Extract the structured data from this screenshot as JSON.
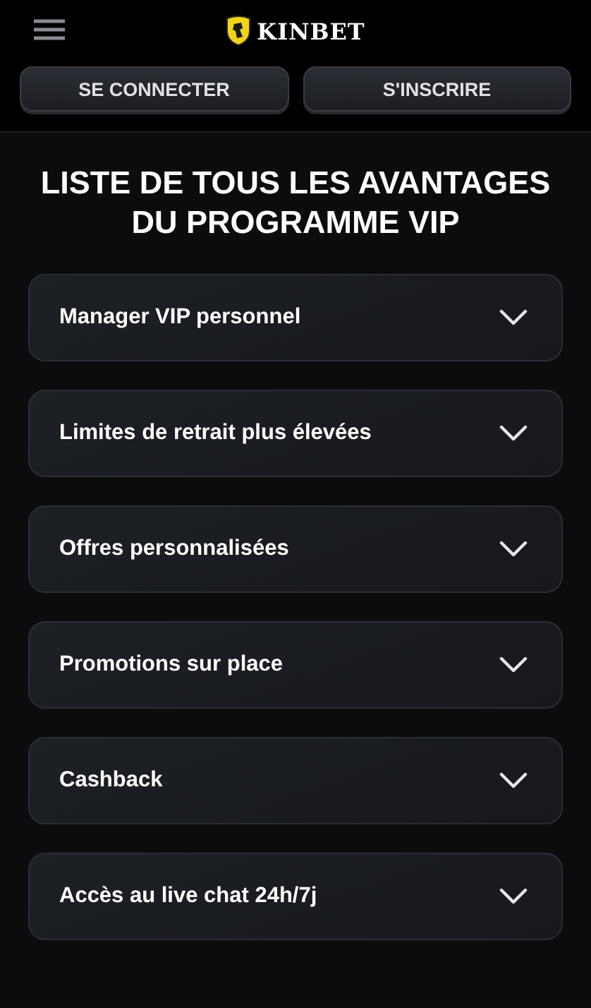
{
  "header": {
    "brand": "KINBET"
  },
  "auth_buttons": [
    "SE CONNECTER",
    "S'INSCRIRE"
  ],
  "heading": "LISTE DE TOUS LES AVANTAGES DU PROGRAMME VIP",
  "benefits": [
    {
      "label": "Manager VIP personnel",
      "expanded": false
    },
    {
      "label": "Limites de retrait plus élevées",
      "expanded": false
    },
    {
      "label": "Offres personnalisées",
      "expanded": false
    },
    {
      "label": "Promotions sur place",
      "expanded": false
    },
    {
      "label": "Cashback",
      "expanded": false
    },
    {
      "label": "Accès au live chat 24h/7j",
      "expanded": false
    }
  ]
}
